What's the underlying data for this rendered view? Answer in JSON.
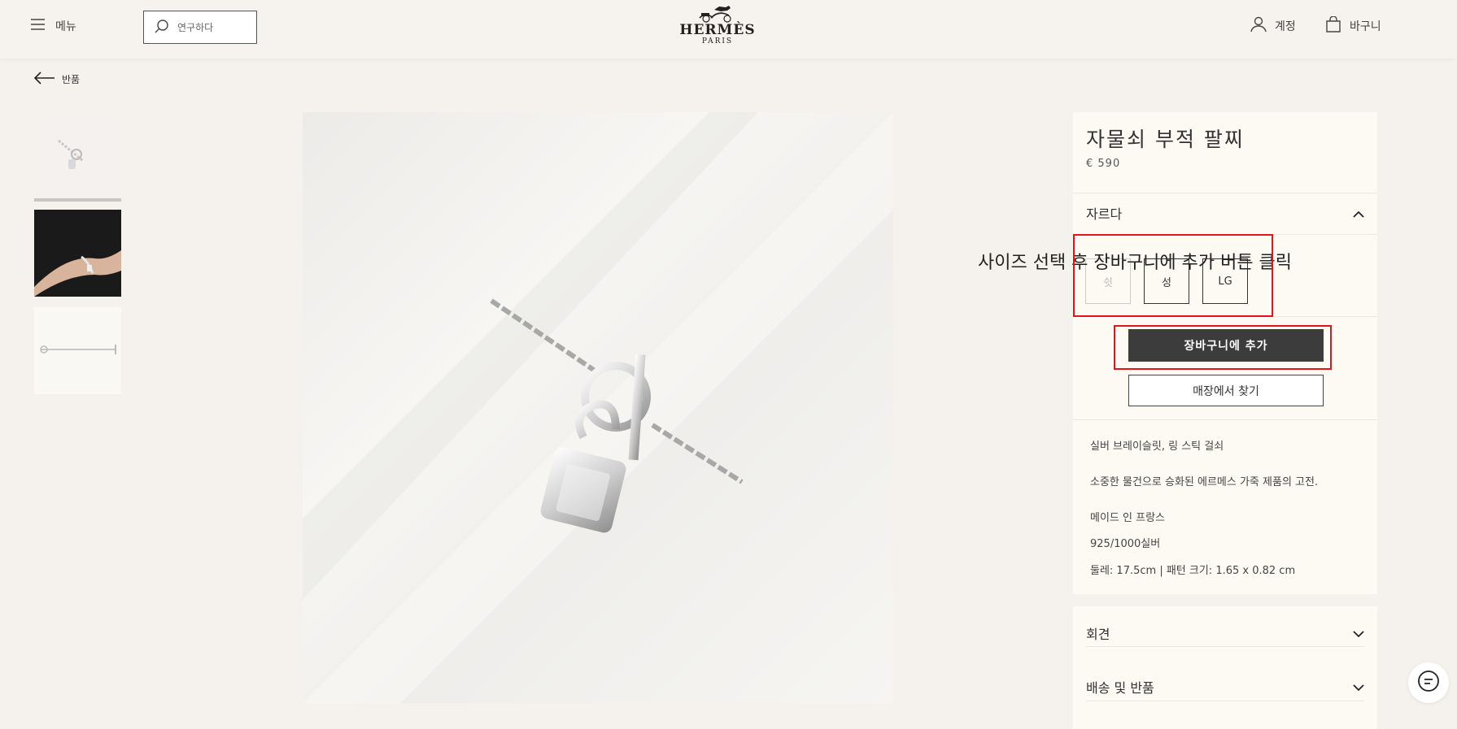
{
  "header": {
    "menu_label": "메뉴",
    "search_placeholder": "연구하다",
    "logo_text": "HERMÈS",
    "logo_subtext": "PARIS",
    "account_label": "계정",
    "cart_label": "바구니"
  },
  "back_label": "반품",
  "product": {
    "title": "자물쇠 부적 팔찌",
    "price": "€ 590",
    "cut_label": "자르다",
    "sizes": [
      "쉿",
      "성",
      "LG"
    ],
    "add_to_cart": "장바구니에 추가",
    "find_in_store": "매장에서 찾기",
    "description": [
      "실버 브레이슬릿, 링 스틱 걸쇠",
      "소중한 물건으로 승화된 에르메스 가죽 제품의 고전.",
      "메이드 인 프랑스",
      "925/1000실버",
      "둘레: 17.5cm | 패턴 크기: 1.65 x 0.82 cm"
    ]
  },
  "accordions": [
    {
      "label": "회견"
    },
    {
      "label": "배송 및 반품"
    }
  ],
  "annotation": {
    "text": "사이즈 선택 후 장바구니에 추가 버튼 클릭",
    "box_color": "#e3131b"
  },
  "colors": {
    "background": "#f5f1ec",
    "panel": "#fdfaf4",
    "primary_button": "#3c3c3c"
  }
}
